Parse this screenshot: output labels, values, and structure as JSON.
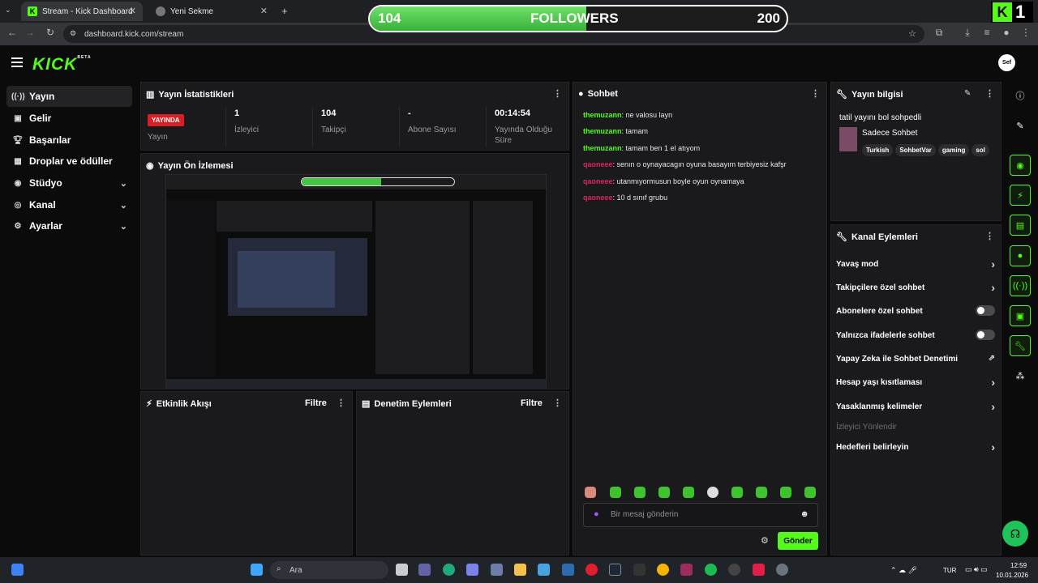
{
  "browser": {
    "tabs": [
      {
        "title": "Stream - Kick Dashboard",
        "active": true
      },
      {
        "title": "Yeni Sekme",
        "active": false
      }
    ],
    "url": "dashboard.kick.com/stream"
  },
  "overlay": {
    "current": "104",
    "label": "FOLLOWERS",
    "goal": "200",
    "progress_fraction": 0.52,
    "corner_count": "1"
  },
  "header": {
    "logo": "KICK",
    "beta": "BETA",
    "avatar_text": "Sef"
  },
  "sidebar": {
    "items": [
      {
        "label": "Yayın",
        "icon": "broadcast-icon",
        "active": true
      },
      {
        "label": "Gelir",
        "icon": "revenue-icon"
      },
      {
        "label": "Başarılar",
        "icon": "trophy-icon"
      },
      {
        "label": "Droplar ve ödüller",
        "icon": "gift-icon"
      },
      {
        "label": "Stüdyo",
        "icon": "studio-icon",
        "expandable": true
      },
      {
        "label": "Kanal",
        "icon": "channel-icon",
        "expandable": true
      },
      {
        "label": "Ayarlar",
        "icon": "gear-icon",
        "expandable": true
      }
    ]
  },
  "stats": {
    "title": "Yayın İstatistikleri",
    "status_badge": "YAYINDA",
    "status_label": "Yayın",
    "items": [
      {
        "value": "1",
        "label": "İzleyici"
      },
      {
        "value": "104",
        "label": "Takipçi"
      },
      {
        "value": "-",
        "label": "Abone Sayısı"
      },
      {
        "value": "00:14:54",
        "label": "Yayında Olduğu Süre"
      }
    ]
  },
  "preview": {
    "title": "Yayın Ön İzlemesi"
  },
  "activity": {
    "title": "Etkinlik Akışı",
    "filter": "Filtre"
  },
  "moderation": {
    "title": "Denetim Eylemleri",
    "filter": "Filtre"
  },
  "chat": {
    "title": "Sohbet",
    "messages": [
      {
        "user": "themuzann",
        "text": "ne valosu layn",
        "color": "#53fc18"
      },
      {
        "user": "themuzann",
        "text": "tamam",
        "color": "#53fc18"
      },
      {
        "user": "themuzann",
        "text": "tamam ben 1 el atıyom",
        "color": "#53fc18"
      },
      {
        "user": "qaoneee",
        "text": "senın o oynayacagın oyuna basayım terbiyesiz kafşr",
        "color": "#e0245e"
      },
      {
        "user": "qaoneee",
        "text": "utanmıyormusun boyle oyun oynamaya",
        "color": "#e0245e"
      },
      {
        "user": "qaoneee",
        "text": "10 d sınıf grubu",
        "color": "#e0245e"
      }
    ],
    "input_placeholder": "Bir mesaj gönderin",
    "send_label": "Gönder"
  },
  "stream_info": {
    "title": "Yayın bilgisi",
    "stream_title": "tatil yayını bol sohpedli",
    "category": "Sadece Sohbet",
    "tags": [
      "Turkish",
      "SohbetVar",
      "gaming",
      "sol"
    ]
  },
  "channel_actions": {
    "title": "Kanal Eylemleri",
    "items": [
      {
        "label": "Yavaş mod",
        "control": "chevron"
      },
      {
        "label": "Takipçilere özel sohbet",
        "control": "chevron"
      },
      {
        "label": "Abonelere özel sohbet",
        "control": "toggle"
      },
      {
        "label": "Yalnızca ifadelerle sohbet",
        "control": "toggle"
      },
      {
        "label": "Yapay Zeka ile Sohbet Denetimi",
        "control": "external"
      },
      {
        "label": "Hesap yaşı kısıtlaması",
        "control": "chevron"
      },
      {
        "label": "Yasaklanmış kelimeler",
        "control": "chevron"
      }
    ],
    "section_label": "İzleyici Yönlendir",
    "goal_item": "Hedefleri belirleyin"
  },
  "taskbar": {
    "search": "Ara",
    "lang": "TUR",
    "time": "12:59",
    "date": "10.01.2026"
  },
  "colors": {
    "accent": "#53fc18",
    "live": "#d91e26",
    "panel": "#1a1a1d"
  }
}
